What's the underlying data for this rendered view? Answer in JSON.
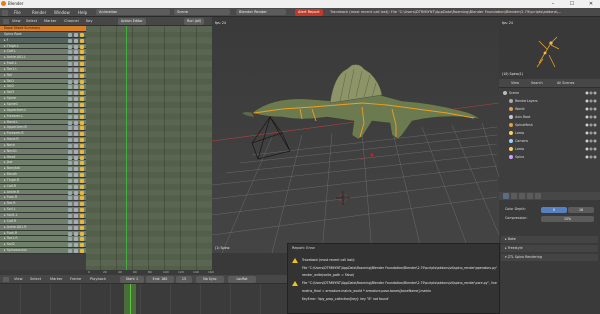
{
  "window": {
    "title": "Blender",
    "controls": [
      "–",
      "☐",
      "✕"
    ]
  },
  "topbar": {
    "menus": [
      "File",
      "Render",
      "Window",
      "Help"
    ],
    "layout": "Animation",
    "scene": "Scene",
    "engine": "Blender Render",
    "error_label": "Alert Report",
    "error_message": "Traceback (most recent call last): File \"C:\\Users\\DTRMIYNT\\AppData\\Roaming\\Blender Foundation\\Blender\\2.79\\scripts\\addons\\..."
  },
  "dopesheet": {
    "menus": [
      "View",
      "Select",
      "Marker",
      "Channel",
      "Key"
    ],
    "mode": "Action Editor",
    "action": "Run (all)",
    "channels": [
      {
        "label": "Dope Sheet Summary",
        "kind": "summary"
      },
      {
        "label": "Spino Root",
        "kind": "obj"
      },
      {
        "label": "▸ f",
        "kind": "obj"
      },
      {
        "label": "▸ Thigh.L",
        "kind": "bone"
      },
      {
        "label": "▸ Calf.L",
        "kind": "bone"
      },
      {
        "label": "▸ Ankle.001.L",
        "kind": "bone"
      },
      {
        "label": "▸ Foot.L",
        "kind": "bone"
      },
      {
        "label": "▸ Toe1.L",
        "kind": "bone"
      },
      {
        "label": "▸ Tail",
        "kind": "bone"
      },
      {
        "label": "▸ Tail1",
        "kind": "bone"
      },
      {
        "label": "▸ Tail2",
        "kind": "bone"
      },
      {
        "label": "▸ Tail3",
        "kind": "bone"
      },
      {
        "label": "▸ Spine",
        "kind": "bone"
      },
      {
        "label": "▸ Spine1",
        "kind": "bone"
      },
      {
        "label": "▸ UpperArm.L",
        "kind": "bone"
      },
      {
        "label": "▸ Forearm.L",
        "kind": "bone"
      },
      {
        "label": "▸ Hand.L",
        "kind": "bone"
      },
      {
        "label": "▸ UpperArm.R",
        "kind": "bone"
      },
      {
        "label": "▸ Forearm.R",
        "kind": "bone"
      },
      {
        "label": "▸ Hand.R",
        "kind": "bone"
      },
      {
        "label": "▸ Neck",
        "kind": "bone"
      },
      {
        "label": "▸ Neck1",
        "kind": "bone"
      },
      {
        "label": "▸ Head",
        "kind": "bone"
      },
      {
        "label": "▸ Jaw",
        "kind": "bone"
      },
      {
        "label": "▸ Bonytail",
        "kind": "bone"
      },
      {
        "label": "▸ Mouth",
        "kind": "bone"
      },
      {
        "label": "▸ Thigh.R",
        "kind": "bone"
      },
      {
        "label": "▸ Calf.R",
        "kind": "bone"
      },
      {
        "label": "▸ Ankle.R",
        "kind": "bone"
      },
      {
        "label": "▸ Foot.R",
        "kind": "bone"
      },
      {
        "label": "▸ Toe.R",
        "kind": "bone"
      },
      {
        "label": "▸ Sail.L",
        "kind": "bone"
      },
      {
        "label": "▸ Sail1.L",
        "kind": "bone"
      },
      {
        "label": "▸ Calf.R",
        "kind": "bone"
      },
      {
        "label": "▸ Ankle.001.R",
        "kind": "bone"
      },
      {
        "label": "▸ Foot.R",
        "kind": "bone"
      },
      {
        "label": "▸ Toe1.R",
        "kind": "bone"
      },
      {
        "label": "▸ Sail2",
        "kind": "bone"
      },
      {
        "label": "▸ Spinosaurus",
        "kind": "bone"
      }
    ],
    "ruler": [
      "0",
      "20",
      "40",
      "60",
      "80",
      "100",
      "120",
      "140",
      "160"
    ]
  },
  "view3d": {
    "label": "fps: 24",
    "object_label": "(1) Spino"
  },
  "outliner": {
    "view_label": "fps: 24",
    "view_object": "(10) Spino(1)",
    "tabs": [
      "View",
      "Search",
      "All Scenes"
    ],
    "rows": [
      {
        "label": "Scene",
        "color": "#bbbbbb"
      },
      {
        "label": "RenderLayers",
        "color": "#aaaaaa"
      },
      {
        "label": "World",
        "color": "#d8a05a"
      },
      {
        "label": "Axis Root",
        "color": "#c8c8c8"
      },
      {
        "label": "SpinoMesh",
        "color": "#e0a040"
      },
      {
        "label": "Lamp",
        "color": "#ffd060"
      },
      {
        "label": "Camera",
        "color": "#9ad0ff"
      },
      {
        "label": "Lamp",
        "color": "#ffd060"
      },
      {
        "label": "Spino",
        "color": "#d0a0ff"
      }
    ]
  },
  "properties": {
    "color_depth_label": "Color Depth:",
    "color_depth_a": "8",
    "color_depth_b": "16",
    "compression_label": "Compression:",
    "compression_value": "15%",
    "panels": [
      "▸ Bake",
      "▸ Freestyle",
      "▾ ZTL Spino Rendering"
    ]
  },
  "report": {
    "title": "Report: Error",
    "lines": [
      "Traceback (most recent call last):",
      "File \"C:\\Users\\DTRMIYNT\\AppData\\Roaming\\Blender Foundation\\Blender\\2.79\\scripts\\addons\\zt\\spino_render\\operators.py\", line 36, in execute",
      "render_write(write_path = False)",
      "File \"C:\\Users\\DTRMIYNT\\AppData\\Roaming\\Blender Foundation\\Blender\\2.79\\scripts\\addons\\zt\\spino_render\\core.py\", line 114, in render_spino",
      "matrix_final = armature.matrix_world * armature.pose.bones[boneName].matrix",
      "KeyError: 'bpy_prop_collection[key]: key \"8\" not found'"
    ]
  },
  "timeline": {
    "menus": [
      "View",
      "Select",
      "Marker",
      "Frame",
      "Playback"
    ],
    "start_label": "Start: 1",
    "end_label": "End: 160",
    "frame_value": "15",
    "sync_label": "No Sync",
    "keying": "LocRot"
  }
}
